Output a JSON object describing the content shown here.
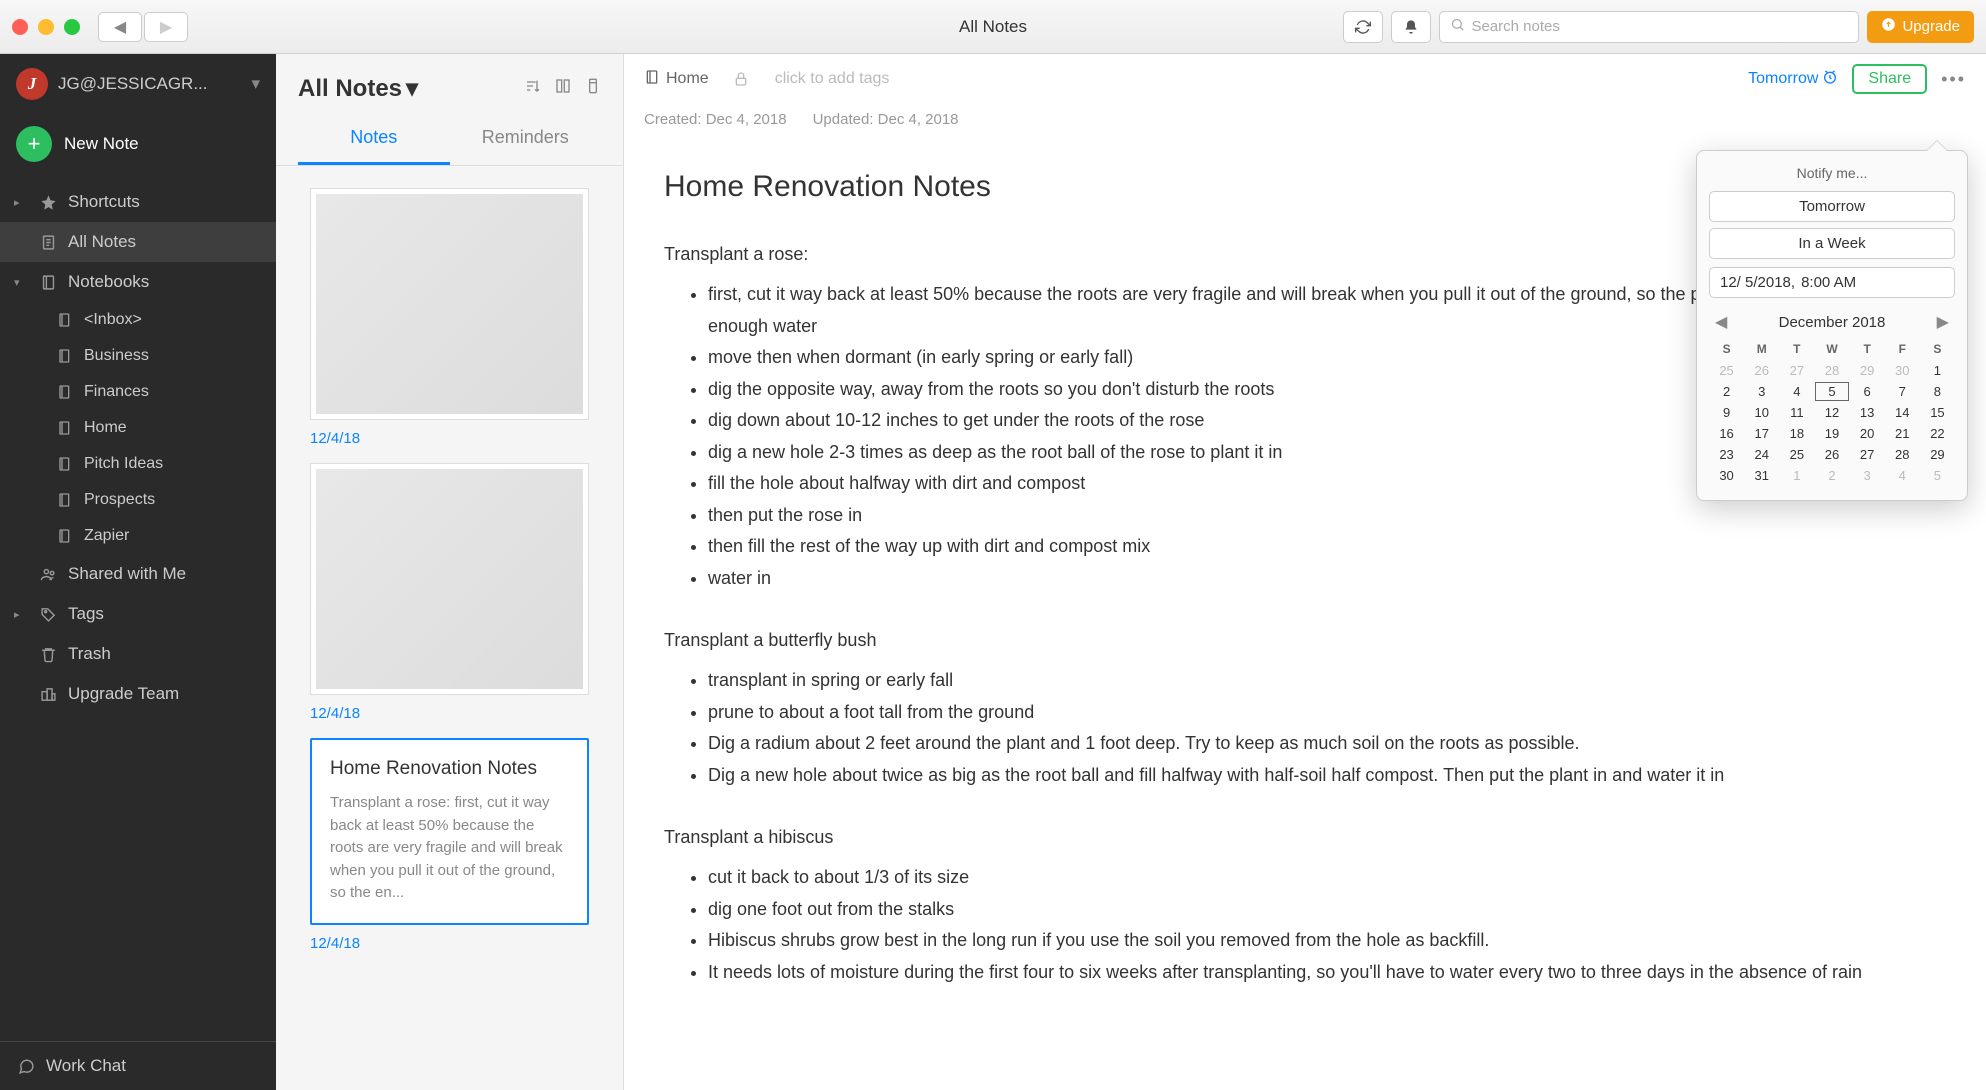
{
  "toolbar": {
    "title": "All Notes",
    "search_placeholder": "Search notes",
    "upgrade_label": "Upgrade"
  },
  "sidebar": {
    "account_label": "JG@JESSICAGR...",
    "new_note_label": "New Note",
    "items": [
      {
        "label": "Shortcuts",
        "icon": "star",
        "expandable": true
      },
      {
        "label": "All Notes",
        "icon": "note",
        "selected": true
      },
      {
        "label": "Notebooks",
        "icon": "notebook",
        "expandable": true,
        "expanded": true
      }
    ],
    "notebooks": [
      "<Inbox>",
      "Business",
      "Finances",
      "Home",
      "Pitch Ideas",
      "Prospects",
      "Zapier"
    ],
    "items_after": [
      {
        "label": "Shared with Me",
        "icon": "shared"
      },
      {
        "label": "Tags",
        "icon": "tag",
        "expandable": true
      },
      {
        "label": "Trash",
        "icon": "trash"
      },
      {
        "label": "Upgrade Team",
        "icon": "team"
      }
    ],
    "chat_label": "Work Chat"
  },
  "notelist": {
    "title": "All Notes",
    "tabs": [
      {
        "label": "Notes",
        "active": true
      },
      {
        "label": "Reminders",
        "active": false
      }
    ],
    "cards": [
      {
        "type": "thumb",
        "date": "12/4/18"
      },
      {
        "type": "thumb",
        "date": "12/4/18"
      },
      {
        "type": "note",
        "selected": true,
        "title": "Home Renovation Notes",
        "preview": "Transplant a rose: first, cut it way back at least 50% because the roots are very fragile and will break when you pull it out of the ground, so the en...",
        "date": "12/4/18"
      }
    ]
  },
  "editor": {
    "breadcrumb_notebook": "Home",
    "tag_placeholder": "click to add tags",
    "tomorrow_label": "Tomorrow",
    "share_label": "Share",
    "meta_created": "Created: Dec 4, 2018",
    "meta_updated": "Updated: Dec 4, 2018",
    "title": "Home Renovation Notes",
    "sections": [
      {
        "heading": "Transplant a rose:",
        "bullets": [
          "first, cut it way back at least 50% because the roots are very fragile and will break when you pull it out of the ground, so the plant won't be able to get enough water",
          "move then when dormant (in early spring or early fall)",
          "dig the opposite way, away from the roots so you don't disturb the roots",
          "dig down about 10-12 inches to get under the roots of the rose",
          "dig a new hole 2-3 times as deep as the root ball of the rose to plant it in",
          "fill the hole about halfway with dirt and compost",
          "then put the rose in",
          "then fill the rest of the way up with dirt and compost mix",
          "water in"
        ]
      },
      {
        "heading": "Transplant a butterfly bush",
        "bullets": [
          "transplant in spring or early fall",
          "prune to about a foot tall from the ground",
          "Dig a radium about 2 feet around the plant and 1 foot deep. Try to keep as much soil on the roots as possible.",
          "Dig a new hole about twice as big as the root ball and fill halfway with half-soil half compost. Then put the plant in and water it in"
        ]
      },
      {
        "heading": "Transplant a hibiscus",
        "bullets": [
          "cut it back to about 1/3 of its size",
          "dig one foot out from the stalks",
          "Hibiscus shrubs grow best in the long run if you use the soil you removed from the hole as backfill.",
          "It needs lots of moisture during the first four to six weeks after transplanting, so you'll have to water every two to three days in the absence of rain"
        ]
      }
    ]
  },
  "popover": {
    "title": "Notify me...",
    "btn_tomorrow": "Tomorrow",
    "btn_week": "In a Week",
    "date_value": "12/  5/2018,",
    "time_value": "8:00 AM",
    "month_label": "December 2018",
    "weekdays": [
      "S",
      "M",
      "T",
      "W",
      "T",
      "F",
      "S"
    ],
    "weeks": [
      [
        {
          "d": 25,
          "off": true
        },
        {
          "d": 26,
          "off": true
        },
        {
          "d": 27,
          "off": true
        },
        {
          "d": 28,
          "off": true
        },
        {
          "d": 29,
          "off": true
        },
        {
          "d": 30,
          "off": true
        },
        {
          "d": 1
        }
      ],
      [
        {
          "d": 2
        },
        {
          "d": 3
        },
        {
          "d": 4
        },
        {
          "d": 5,
          "sel": true
        },
        {
          "d": 6
        },
        {
          "d": 7
        },
        {
          "d": 8
        }
      ],
      [
        {
          "d": 9
        },
        {
          "d": 10
        },
        {
          "d": 11
        },
        {
          "d": 12
        },
        {
          "d": 13
        },
        {
          "d": 14
        },
        {
          "d": 15
        }
      ],
      [
        {
          "d": 16
        },
        {
          "d": 17
        },
        {
          "d": 18
        },
        {
          "d": 19
        },
        {
          "d": 20
        },
        {
          "d": 21
        },
        {
          "d": 22
        }
      ],
      [
        {
          "d": 23
        },
        {
          "d": 24
        },
        {
          "d": 25
        },
        {
          "d": 26
        },
        {
          "d": 27
        },
        {
          "d": 28
        },
        {
          "d": 29
        }
      ],
      [
        {
          "d": 30
        },
        {
          "d": 31
        },
        {
          "d": 1,
          "off": true
        },
        {
          "d": 2,
          "off": true
        },
        {
          "d": 3,
          "off": true
        },
        {
          "d": 4,
          "off": true
        },
        {
          "d": 5,
          "off": true
        }
      ]
    ]
  }
}
